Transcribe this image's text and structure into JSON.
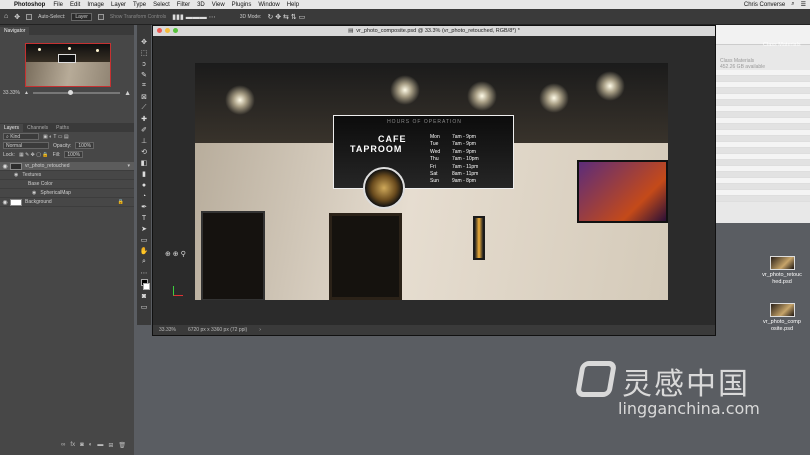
{
  "menubar": {
    "app": "Photoshop",
    "items": [
      "File",
      "Edit",
      "Image",
      "Layer",
      "Type",
      "Select",
      "Filter",
      "3D",
      "View",
      "Plugins",
      "Window",
      "Help"
    ],
    "user": "Chris Converse"
  },
  "options": {
    "auto_select_label": "Auto-Select:",
    "auto_select_value": "Layer",
    "transform_label": "Show Transform Controls",
    "mode3d_label": "3D Mode:"
  },
  "navigator": {
    "tab": "Navigator",
    "zoom": "33.33%"
  },
  "layers": {
    "tabs": [
      "Layers",
      "Channels",
      "Paths"
    ],
    "kind": "Kind",
    "blend": "Normal",
    "opacity_label": "Opacity:",
    "opacity": "100%",
    "lock_label": "Lock:",
    "fill_label": "Fill:",
    "fill": "100%",
    "items": [
      {
        "name": "vr_photo_retouched",
        "indent": 0
      },
      {
        "name": "Textures",
        "indent": 1
      },
      {
        "name": "Base Color",
        "indent": 2
      },
      {
        "name": "SphericalMap",
        "indent": 3
      },
      {
        "name": "Background",
        "indent": 0
      }
    ]
  },
  "document": {
    "title": "vr_photo_composite.psd @ 33.3% (vr_photo_retouched, RGB/8*) *",
    "status_zoom": "33.33%",
    "status_info": "6720 px x 3360 px (72 ppi)"
  },
  "sign": {
    "heading": "HOURS OF OPERATION",
    "brand_line1": "CAFE",
    "brand_line2": "TAPROOM",
    "hours": [
      {
        "day": "Mon",
        "time": "7am - 9pm"
      },
      {
        "day": "Tue",
        "time": "7am - 9pm"
      },
      {
        "day": "Wed",
        "time": "7am - 9pm"
      },
      {
        "day": "Thu",
        "time": "7am - 10pm"
      },
      {
        "day": "Fri",
        "time": "7am - 11pm"
      },
      {
        "day": "Sat",
        "time": "8am - 11pm"
      },
      {
        "day": "Sun",
        "time": "9am - 8pm"
      }
    ]
  },
  "right_panel": {
    "title": "Class Materials",
    "meta_line1": "Class Materials",
    "meta_line2": "452.26 GB available"
  },
  "desktop": {
    "files": [
      {
        "name": "vr_photo_retouched.psd"
      },
      {
        "name": "vr_photo_composite.psd"
      }
    ]
  },
  "watermark": {
    "cn": "灵感中国",
    "en": "lingganchina.com"
  }
}
